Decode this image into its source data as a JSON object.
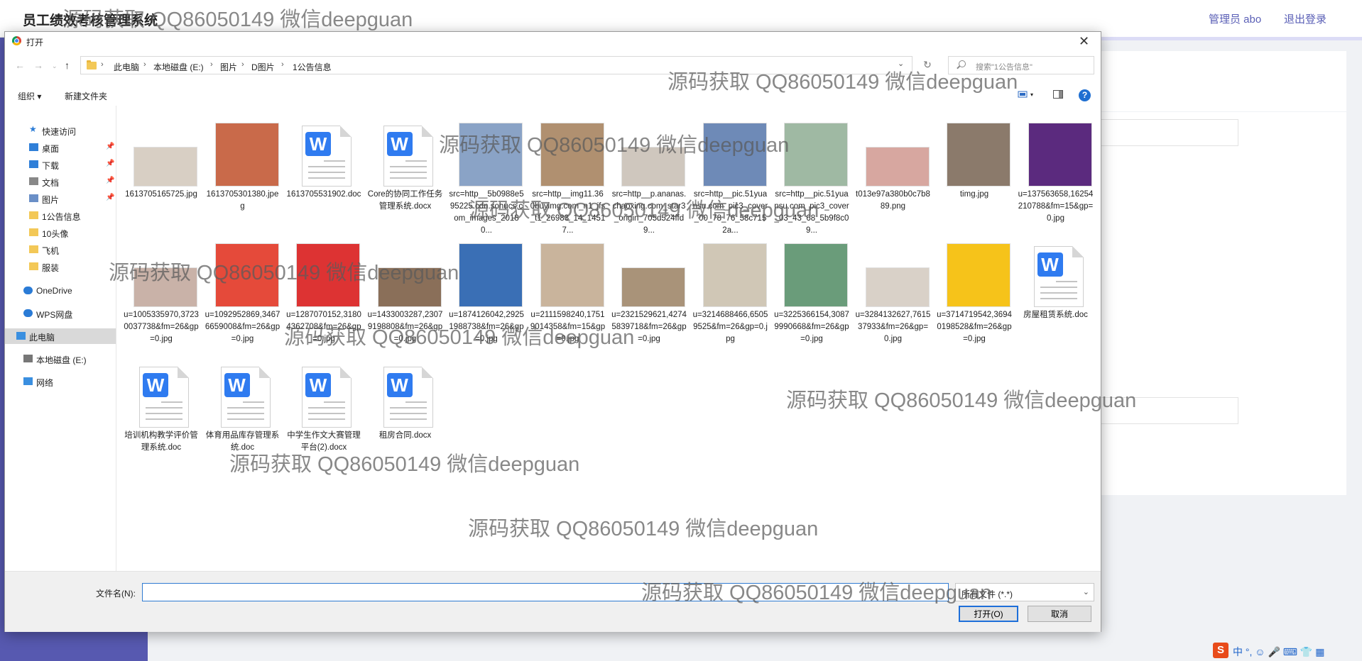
{
  "app": {
    "title": "员工绩效考核管理系统",
    "user_label": "管理员 abo",
    "logout_label": "退出登录"
  },
  "watermark": "源码获取 QQ86050149 微信deepguan",
  "dialog": {
    "title": "打开",
    "close_icon": "close-icon",
    "breadcrumb": [
      "此电脑",
      "本地磁盘 (E:)",
      "图片",
      "D图片",
      "1公告信息"
    ],
    "search_placeholder": "搜索\"1公告信息\"",
    "toolbar": {
      "organize": "组织 ▾",
      "new_folder": "新建文件夹"
    },
    "sidebar": [
      {
        "label": "快速访问",
        "icon": "star-icon"
      },
      {
        "label": "桌面",
        "icon": "desktop-icon",
        "pinned": true
      },
      {
        "label": "下载",
        "icon": "download-icon",
        "pinned": true
      },
      {
        "label": "文档",
        "icon": "document-icon",
        "pinned": true
      },
      {
        "label": "图片",
        "icon": "picture-icon",
        "pinned": true
      },
      {
        "label": "1公告信息",
        "icon": "folder-icon"
      },
      {
        "label": "10头像",
        "icon": "folder-icon"
      },
      {
        "label": "飞机",
        "icon": "folder-icon"
      },
      {
        "label": "服装",
        "icon": "folder-icon"
      },
      {
        "label": "OneDrive",
        "icon": "cloud-icon"
      },
      {
        "label": "WPS网盘",
        "icon": "cloud-icon"
      },
      {
        "label": "此电脑",
        "icon": "computer-icon",
        "selected": true
      },
      {
        "label": "本地磁盘 (E:)",
        "icon": "drive-icon"
      },
      {
        "label": "网络",
        "icon": "network-icon"
      }
    ],
    "files": [
      {
        "name": "1613705165725.jpg",
        "kind": "image"
      },
      {
        "name": "1613705301380.jpeg",
        "kind": "image"
      },
      {
        "name": "1613705531902.doc",
        "kind": "doc"
      },
      {
        "name": "Core的协同工作任务管理系统.docx",
        "kind": "doc"
      },
      {
        "name": "src=http__5b0988e595225.cdn.sohucs.com_images_20180...",
        "kind": "image"
      },
      {
        "name": "src=http__img11.360buyimg.com_n1_jfs_t1_26983_14_14517...",
        "kind": "image"
      },
      {
        "name": "src=http__p.ananas.chaoxing.com_star3_origin_705d524ffd9...",
        "kind": "image"
      },
      {
        "name": "src=http__pic.51yuansu.com_pic3_cover_00_78_76_58c7152a...",
        "kind": "image"
      },
      {
        "name": "src=http__pic.51yuansu.com_pic3_cover_03_43_68_5b9f8c09...",
        "kind": "image"
      },
      {
        "name": "t013e97a380b0c7b889.png",
        "kind": "image"
      },
      {
        "name": "timg.jpg",
        "kind": "image"
      },
      {
        "name": "u=137563658,16254210788&fm=15&gp=0.jpg",
        "kind": "image"
      },
      {
        "name": "u=1005335970,37230037738&fm=26&gp=0.jpg",
        "kind": "image"
      },
      {
        "name": "u=1092952869,34676659008&fm=26&gp=0.jpg",
        "kind": "image"
      },
      {
        "name": "u=1287070152,31804362708&fm=26&gp=0.jpg",
        "kind": "image"
      },
      {
        "name": "u=1433003287,23079198808&fm=26&gp=0.jpg",
        "kind": "image"
      },
      {
        "name": "u=1874126042,29251988738&fm=26&gp=0.jpg",
        "kind": "image"
      },
      {
        "name": "u=2111598240,17519014358&fm=15&gp=0.jpg",
        "kind": "image"
      },
      {
        "name": "u=2321529621,42745839718&fm=26&gp=0.jpg",
        "kind": "image"
      },
      {
        "name": "u=3214688466,65059525&fm=26&gp=0.jpg",
        "kind": "image"
      },
      {
        "name": "u=3225366154,30879990668&fm=26&gp=0.jpg",
        "kind": "image"
      },
      {
        "name": "u=3284132627,761537933&fm=26&gp=0.jpg",
        "kind": "image"
      },
      {
        "name": "u=3714719542,36940198528&fm=26&gp=0.jpg",
        "kind": "image"
      },
      {
        "name": "房屋租赁系统.doc",
        "kind": "doc"
      },
      {
        "name": "培训机构教学评价管理系统.doc",
        "kind": "doc"
      },
      {
        "name": "体育用品库存管理系统.doc",
        "kind": "doc"
      },
      {
        "name": "中学生作文大赛管理平台(2).docx",
        "kind": "doc"
      },
      {
        "name": "租房合同.docx",
        "kind": "doc"
      }
    ],
    "filename_label": "文件名(N):",
    "filename_value": "",
    "filetype_value": "所有文件 (*.*)",
    "open_label": "打开(O)",
    "cancel_label": "取消"
  },
  "tray": {
    "ime_labels": "中 °, ☺ 🎤 ⌨ 👕 ▦"
  }
}
